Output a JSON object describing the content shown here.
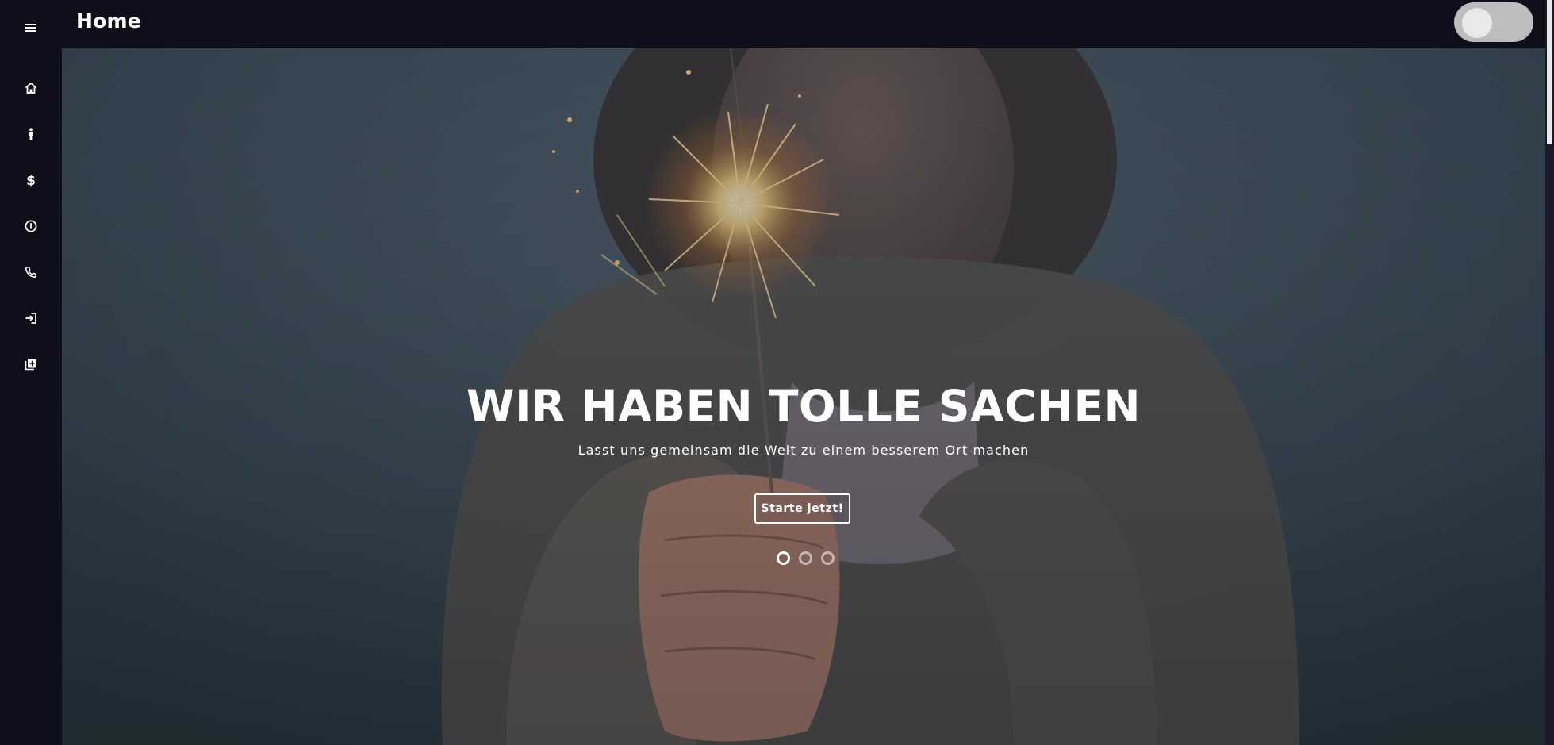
{
  "header": {
    "menu_icon": "hamburger-menu-icon",
    "title": "Home",
    "theme_toggle": {
      "state": "off"
    }
  },
  "sidebar": {
    "items": [
      {
        "icon": "home-icon"
      },
      {
        "icon": "person-icon"
      },
      {
        "icon": "dollar-icon"
      },
      {
        "icon": "info-icon"
      },
      {
        "icon": "phone-icon"
      },
      {
        "icon": "login-icon"
      },
      {
        "icon": "add-box-icon"
      }
    ]
  },
  "hero": {
    "title": "WIR HABEN TOLLE SACHEN",
    "subtitle": "Lasst uns gemeinsam die Welt zu einem besserem Ort machen",
    "cta_label": "Starte jetzt!",
    "carousel": {
      "slide_count": 3,
      "active_slide": 1
    }
  },
  "colors": {
    "background": "#0f0f1c",
    "text": "#ffffff",
    "toggle_track": "#bdbdbd"
  }
}
